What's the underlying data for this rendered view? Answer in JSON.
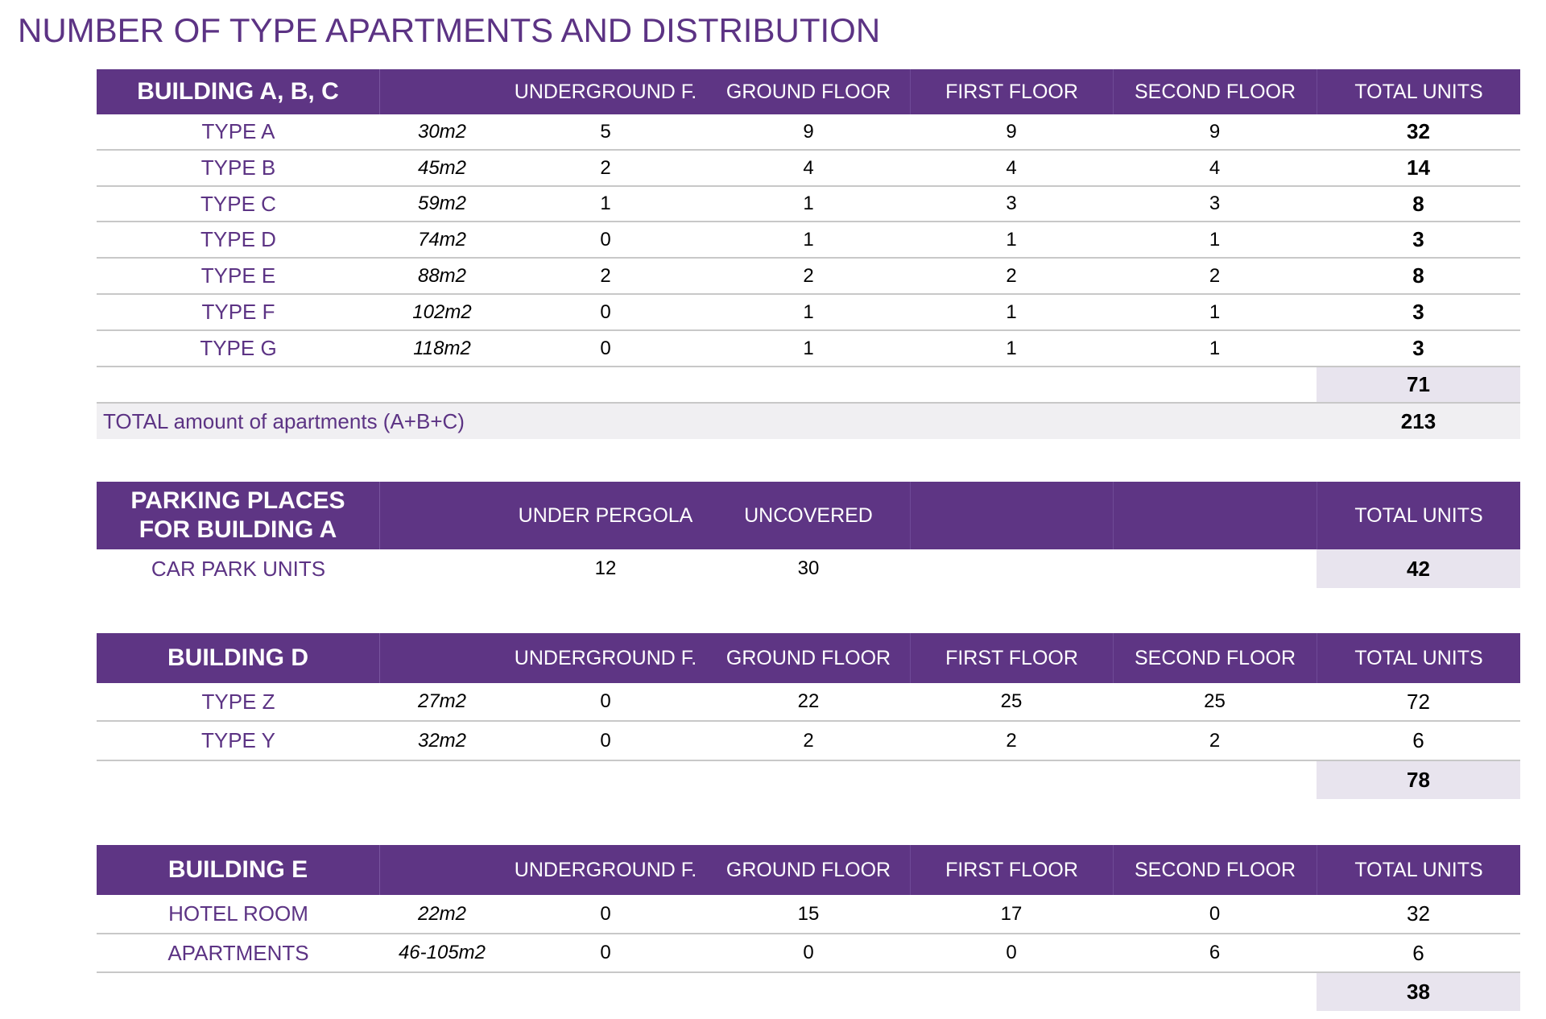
{
  "title": "NUMBER OF TYPE APARTMENTS AND DISTRIBUTION",
  "colors": {
    "header_bg": "#5e3584",
    "accent_text": "#5c3384",
    "total_bg": "#e8e4ee",
    "row_border": "#c8c8c8"
  },
  "building_abc": {
    "header": [
      "BUILDING A, B, C",
      "",
      "UNDERGROUND F.",
      "GROUND FLOOR",
      "FIRST FLOOR",
      "SECOND FLOOR",
      "TOTAL UNITS"
    ],
    "rows": [
      [
        "TYPE A",
        "30m2",
        "5",
        "9",
        "9",
        "9",
        "32"
      ],
      [
        "TYPE B",
        "45m2",
        "2",
        "4",
        "4",
        "4",
        "14"
      ],
      [
        "TYPE C",
        "59m2",
        "1",
        "1",
        "3",
        "3",
        "8"
      ],
      [
        "TYPE D",
        "74m2",
        "0",
        "1",
        "1",
        "1",
        "3"
      ],
      [
        "TYPE E",
        "88m2",
        "2",
        "2",
        "2",
        "2",
        "8"
      ],
      [
        "TYPE F",
        "102m2",
        "0",
        "1",
        "1",
        "1",
        "3"
      ],
      [
        "TYPE G",
        "118m2",
        "0",
        "1",
        "1",
        "1",
        "3"
      ]
    ],
    "subtotal": "71",
    "grand_total_label": "TOTAL amount of apartments (A+B+C)",
    "grand_total": "213"
  },
  "parking": {
    "header_line1": "PARKING PLACES",
    "header_line2": "FOR BUILDING A",
    "header": [
      "",
      "",
      "UNDER PERGOLA",
      "UNCOVERED",
      "",
      "",
      "TOTAL UNITS"
    ],
    "row": [
      "CAR PARK UNITS",
      "",
      "12",
      "30",
      "",
      "",
      "42"
    ]
  },
  "building_d": {
    "header": [
      "BUILDING D",
      "",
      "UNDERGROUND F.",
      "GROUND FLOOR",
      "FIRST FLOOR",
      "SECOND FLOOR",
      "TOTAL UNITS"
    ],
    "rows": [
      [
        "TYPE Z",
        "27m2",
        "0",
        "22",
        "25",
        "25",
        "72"
      ],
      [
        "TYPE Y",
        "32m2",
        "0",
        "2",
        "2",
        "2",
        "6"
      ]
    ],
    "subtotal": "78"
  },
  "building_e": {
    "header": [
      "BUILDING E",
      "",
      "UNDERGROUND F.",
      "GROUND FLOOR",
      "FIRST FLOOR",
      "SECOND FLOOR",
      "TOTAL UNITS"
    ],
    "rows": [
      [
        "HOTEL ROOM",
        "22m2",
        "0",
        "15",
        "17",
        "0",
        "32"
      ],
      [
        "APARTMENTS",
        "46-105m2",
        "0",
        "0",
        "0",
        "6",
        "6"
      ]
    ],
    "subtotal": "38"
  }
}
